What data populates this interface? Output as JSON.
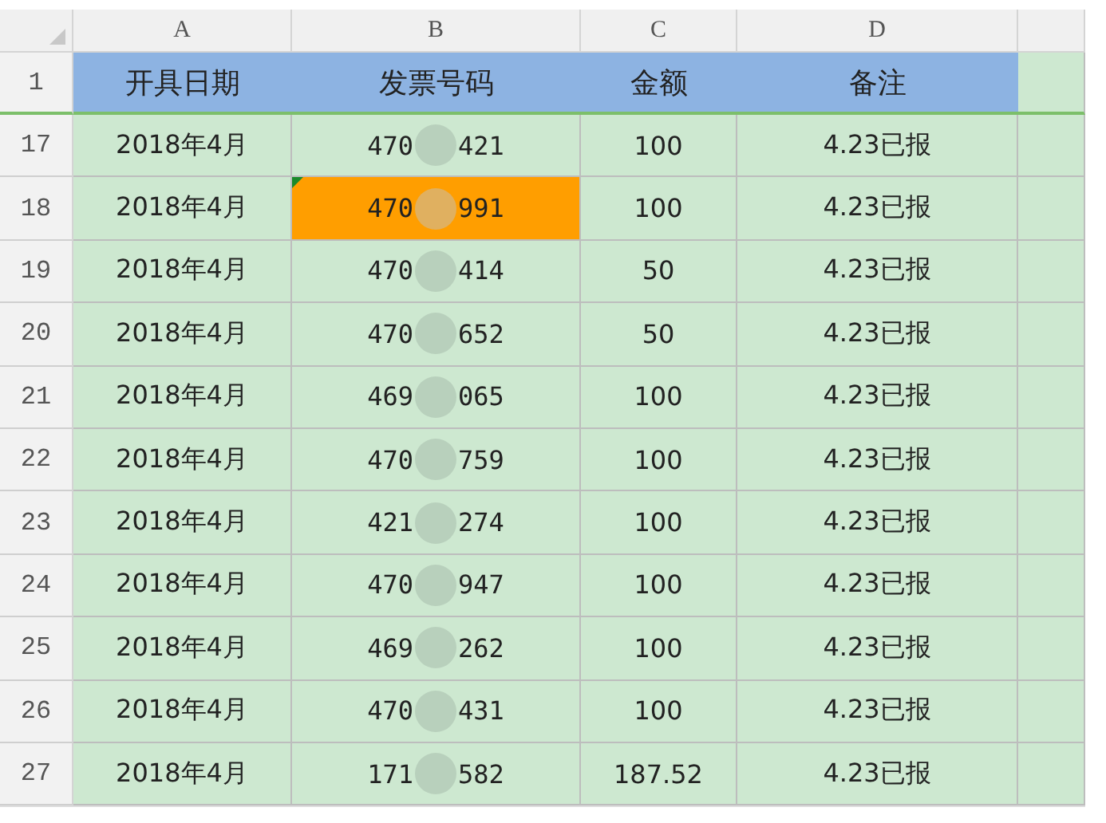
{
  "columns": [
    "A",
    "B",
    "C",
    "D"
  ],
  "header_row": {
    "number": "1",
    "cells": [
      "开具日期",
      "发票号码",
      "金额",
      "备注"
    ]
  },
  "rows": [
    {
      "number": "17",
      "date": "2018年4月",
      "invoice_start": "470",
      "invoice_end": "421",
      "amount": "100",
      "note": "4.23已报",
      "selected": false
    },
    {
      "number": "18",
      "date": "2018年4月",
      "invoice_start": "470",
      "invoice_end": "991",
      "amount": "100",
      "note": "4.23已报",
      "selected": true
    },
    {
      "number": "19",
      "date": "2018年4月",
      "invoice_start": "470",
      "invoice_end": "414",
      "amount": "50",
      "note": "4.23已报",
      "selected": false
    },
    {
      "number": "20",
      "date": "2018年4月",
      "invoice_start": "470",
      "invoice_end": "652",
      "amount": "50",
      "note": "4.23已报",
      "selected": false
    },
    {
      "number": "21",
      "date": "2018年4月",
      "invoice_start": "469",
      "invoice_end": "065",
      "amount": "100",
      "note": "4.23已报",
      "selected": false
    },
    {
      "number": "22",
      "date": "2018年4月",
      "invoice_start": "470",
      "invoice_end": "759",
      "amount": "100",
      "note": "4.23已报",
      "selected": false
    },
    {
      "number": "23",
      "date": "2018年4月",
      "invoice_start": "421",
      "invoice_end": "274",
      "amount": "100",
      "note": "4.23已报",
      "selected": false
    },
    {
      "number": "24",
      "date": "2018年4月",
      "invoice_start": "470",
      "invoice_end": "947",
      "amount": "100",
      "note": "4.23已报",
      "selected": false
    },
    {
      "number": "25",
      "date": "2018年4月",
      "invoice_start": "469",
      "invoice_end": "262",
      "amount": "100",
      "note": "4.23已报",
      "selected": false
    },
    {
      "number": "26",
      "date": "2018年4月",
      "invoice_start": "470",
      "invoice_end": "431",
      "amount": "100",
      "note": "4.23已报",
      "selected": false
    },
    {
      "number": "27",
      "date": "2018年4月",
      "invoice_start": "171",
      "invoice_end": "582",
      "amount": "187.52",
      "note": "4.23已报",
      "selected": false
    }
  ]
}
